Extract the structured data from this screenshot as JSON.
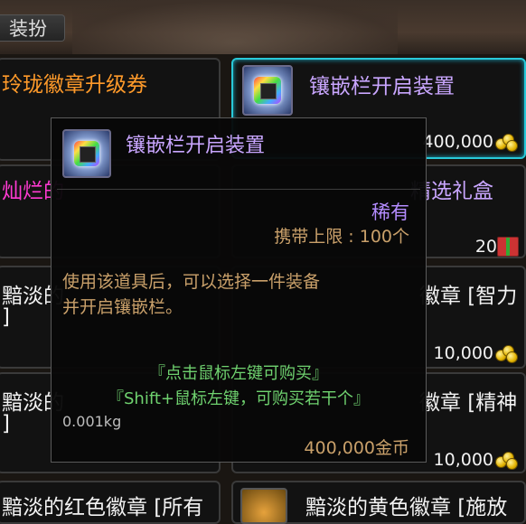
{
  "tab": {
    "label": "装扮"
  },
  "slots": [
    {
      "label": "玲珑徽章升级券",
      "price": ""
    },
    {
      "label": "镶嵌栏开启装置",
      "price": "400,000"
    },
    {
      "label": "灿烂的",
      "price": ""
    },
    {
      "label": "精选礼盒",
      "price": "20"
    },
    {
      "label": "黯淡的",
      "label2": "]",
      "price": ""
    },
    {
      "label": "徽章 [智力",
      "price": "10,000"
    },
    {
      "label": "黯淡的",
      "label2": "]",
      "price": ""
    },
    {
      "label": "徽章 [精神",
      "price": "10,000"
    },
    {
      "label": "黯淡的红色徽章 [所有",
      "price": ""
    },
    {
      "label": "黯淡的黄色徽章 [施放",
      "price": ""
    }
  ],
  "tooltip": {
    "name": "镶嵌栏开启装置",
    "rarity": "稀有",
    "carry_limit": "携带上限 : 100个",
    "desc_line1": "使用该道具后，可以选择一件装备",
    "desc_line2": "并开启镶嵌栏。",
    "hint_click": "『点击鼠标左键可购买』",
    "hint_shift": "『Shift+鼠标左键，可购买若干个』",
    "weight": "0.001kg",
    "price": "400,000金币"
  },
  "colors": {
    "item_name": "#c9a6ff",
    "rarity": "#b48cff",
    "desc": "#c9a06a",
    "hint": "#6fd26f",
    "orange_label": "#ff9a2a",
    "pink_label": "#ff3ad2"
  }
}
